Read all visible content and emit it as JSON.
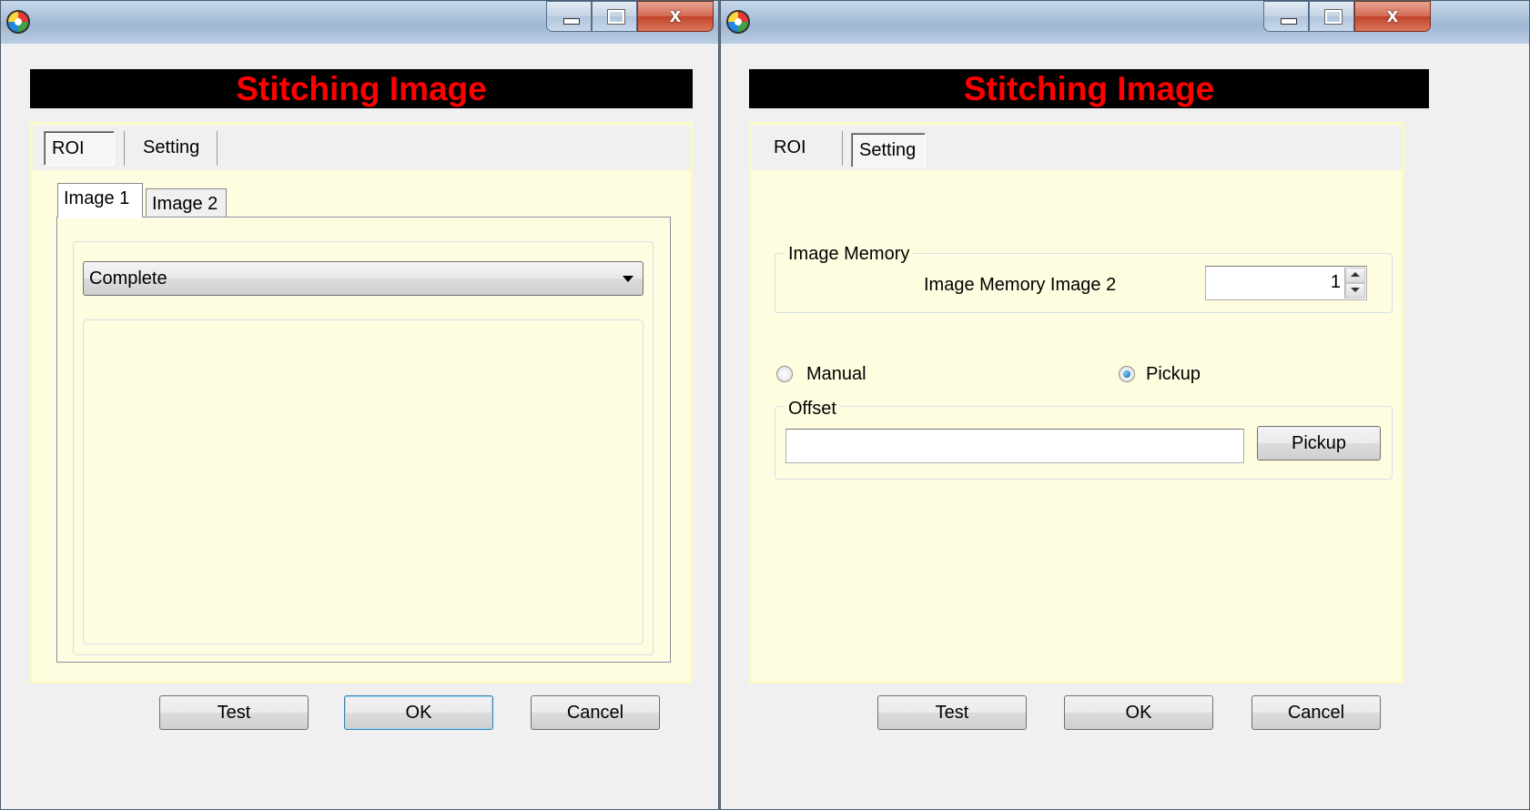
{
  "windows": [
    {
      "banner": "Stitching Image",
      "tabs": [
        "ROI",
        "Setting"
      ],
      "selected_tab": "ROI",
      "subtabs": [
        "Image 1",
        "Image 2"
      ],
      "selected_subtab": "Image 1",
      "combo_value": "Complete",
      "buttons": {
        "test": "Test",
        "ok": "OK",
        "cancel": "Cancel"
      },
      "title_controls": {
        "close": "x"
      }
    },
    {
      "banner": "Stitching Image",
      "tabs": [
        "ROI",
        "Setting"
      ],
      "selected_tab": "Setting",
      "image_memory": {
        "legend": "Image Memory",
        "label": "Image Memory Image 2",
        "value": "1"
      },
      "mode": {
        "manual": "Manual",
        "pickup": "Pickup",
        "selected": "Pickup"
      },
      "offset": {
        "legend": "Offset",
        "value": "",
        "button": "Pickup"
      },
      "buttons": {
        "test": "Test",
        "ok": "OK",
        "cancel": "Cancel"
      },
      "title_controls": {
        "close": "x"
      }
    }
  ]
}
